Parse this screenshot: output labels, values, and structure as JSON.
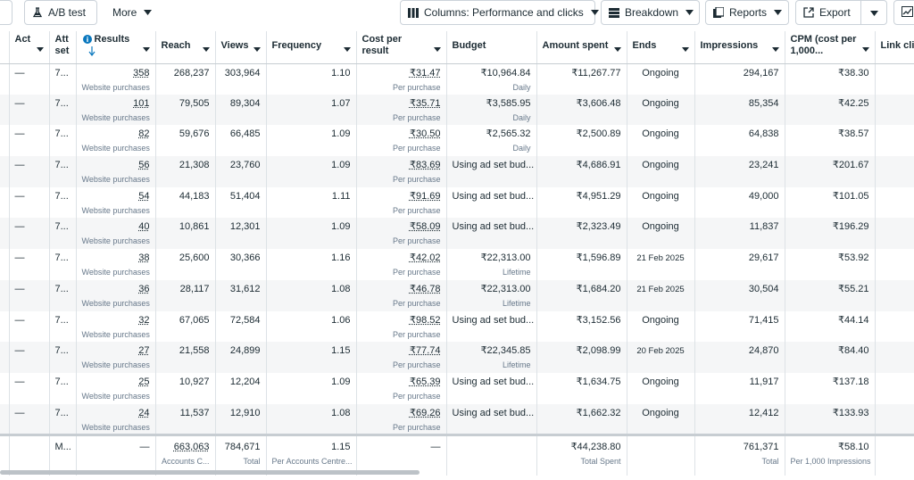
{
  "toolbar": {
    "ab_test": "A/B test",
    "more": "More",
    "columns": "Columns: Performance and clicks",
    "breakdown": "Breakdown",
    "reports": "Reports",
    "export": "Export"
  },
  "columns": [
    {
      "label": ""
    },
    {
      "label": "Act"
    },
    {
      "label": "Att set"
    },
    {
      "label": "Results"
    },
    {
      "label": "Reach"
    },
    {
      "label": "Views"
    },
    {
      "label": "Frequency"
    },
    {
      "label": "Cost per result"
    },
    {
      "label": "Budget"
    },
    {
      "label": "Amount spent"
    },
    {
      "label": "Ends"
    },
    {
      "label": "Impressions"
    },
    {
      "label": "CPM (cost per 1,000..."
    },
    {
      "label": "Link cli"
    }
  ],
  "rows": [
    {
      "act": "—",
      "att": "7...",
      "results": "358",
      "results_sub": "Website purchases",
      "reach": "268,237",
      "views": "303,964",
      "frequency": "1.10",
      "cpr": "₹31.47",
      "cpr_sub": "Per purchase",
      "budget": "₹10,964.84",
      "budget_sub": "Daily",
      "spent": "₹11,267.77",
      "ends": "Ongoing",
      "impressions": "294,167",
      "cpm": "₹38.30"
    },
    {
      "act": "—",
      "att": "7...",
      "results": "101",
      "results_sub": "Website purchases",
      "reach": "79,505",
      "views": "89,304",
      "frequency": "1.07",
      "cpr": "₹35.71",
      "cpr_sub": "Per purchase",
      "budget": "₹3,585.95",
      "budget_sub": "Daily",
      "spent": "₹3,606.48",
      "ends": "Ongoing",
      "impressions": "85,354",
      "cpm": "₹42.25"
    },
    {
      "act": "—",
      "att": "7...",
      "results": "82",
      "results_sub": "Website purchases",
      "reach": "59,676",
      "views": "66,485",
      "frequency": "1.09",
      "cpr": "₹30.50",
      "cpr_sub": "Per purchase",
      "budget": "₹2,565.32",
      "budget_sub": "Daily",
      "spent": "₹2,500.89",
      "ends": "Ongoing",
      "impressions": "64,838",
      "cpm": "₹38.57"
    },
    {
      "act": "—",
      "att": "7...",
      "results": "56",
      "results_sub": "Website purchases",
      "reach": "21,308",
      "views": "23,760",
      "frequency": "1.09",
      "cpr": "₹83.69",
      "cpr_sub": "Per purchase",
      "budget": "Using ad set bud...",
      "budget_sub": "",
      "spent": "₹4,686.91",
      "ends": "Ongoing",
      "impressions": "23,241",
      "cpm": "₹201.67"
    },
    {
      "act": "—",
      "att": "7...",
      "results": "54",
      "results_sub": "Website purchases",
      "reach": "44,183",
      "views": "51,404",
      "frequency": "1.11",
      "cpr": "₹91.69",
      "cpr_sub": "Per purchase",
      "budget": "Using ad set bud...",
      "budget_sub": "",
      "spent": "₹4,951.29",
      "ends": "Ongoing",
      "impressions": "49,000",
      "cpm": "₹101.05"
    },
    {
      "act": "—",
      "att": "7...",
      "results": "40",
      "results_sub": "Website purchases",
      "reach": "10,861",
      "views": "12,301",
      "frequency": "1.09",
      "cpr": "₹58.09",
      "cpr_sub": "Per purchase",
      "budget": "Using ad set bud...",
      "budget_sub": "",
      "spent": "₹2,323.49",
      "ends": "Ongoing",
      "impressions": "11,837",
      "cpm": "₹196.29"
    },
    {
      "act": "—",
      "att": "7...",
      "results": "38",
      "results_sub": "Website purchases",
      "reach": "25,600",
      "views": "30,366",
      "frequency": "1.16",
      "cpr": "₹42.02",
      "cpr_sub": "Per purchase",
      "budget": "₹22,313.00",
      "budget_sub": "Lifetime",
      "spent": "₹1,596.89",
      "ends": "21 Feb 2025",
      "impressions": "29,617",
      "cpm": "₹53.92"
    },
    {
      "act": "—",
      "att": "7...",
      "results": "36",
      "results_sub": "Website purchases",
      "reach": "28,117",
      "views": "31,612",
      "frequency": "1.08",
      "cpr": "₹46.78",
      "cpr_sub": "Per purchase",
      "budget": "₹22,313.00",
      "budget_sub": "Lifetime",
      "spent": "₹1,684.20",
      "ends": "21 Feb 2025",
      "impressions": "30,504",
      "cpm": "₹55.21"
    },
    {
      "act": "—",
      "att": "7...",
      "results": "32",
      "results_sub": "Website purchases",
      "reach": "67,065",
      "views": "72,584",
      "frequency": "1.06",
      "cpr": "₹98.52",
      "cpr_sub": "Per purchase",
      "budget": "Using ad set bud...",
      "budget_sub": "",
      "spent": "₹3,152.56",
      "ends": "Ongoing",
      "impressions": "71,415",
      "cpm": "₹44.14"
    },
    {
      "act": "—",
      "att": "7...",
      "results": "27",
      "results_sub": "Website purchases",
      "reach": "21,558",
      "views": "24,899",
      "frequency": "1.15",
      "cpr": "₹77.74",
      "cpr_sub": "Per purchase",
      "budget": "₹22,345.85",
      "budget_sub": "Lifetime",
      "spent": "₹2,098.99",
      "ends": "20 Feb 2025",
      "impressions": "24,870",
      "cpm": "₹84.40"
    },
    {
      "act": "—",
      "att": "7...",
      "results": "25",
      "results_sub": "Website purchases",
      "reach": "10,927",
      "views": "12,204",
      "frequency": "1.09",
      "cpr": "₹65.39",
      "cpr_sub": "Per purchase",
      "budget": "Using ad set bud...",
      "budget_sub": "",
      "spent": "₹1,634.75",
      "ends": "Ongoing",
      "impressions": "11,917",
      "cpm": "₹137.18"
    },
    {
      "act": "—",
      "att": "7...",
      "results": "24",
      "results_sub": "Website purchases",
      "reach": "11,537",
      "views": "12,910",
      "frequency": "1.08",
      "cpr": "₹69.26",
      "cpr_sub": "Per purchase",
      "budget": "Using ad set bud...",
      "budget_sub": "",
      "spent": "₹1,662.32",
      "ends": "Ongoing",
      "impressions": "12,412",
      "cpm": "₹133.93"
    }
  ],
  "totals": {
    "att": "M...",
    "results": "—",
    "reach": "663,063",
    "reach_sub": "Accounts C...",
    "views": "784,671",
    "views_sub": "Total",
    "frequency": "1.15",
    "frequency_sub": "Per Accounts Centre...",
    "cpr": "—",
    "spent": "₹44,238.80",
    "spent_sub": "Total Spent",
    "impressions": "761,371",
    "impressions_sub": "Total",
    "cpm": "₹58.10",
    "cpm_sub": "Per 1,000 Impressions"
  }
}
